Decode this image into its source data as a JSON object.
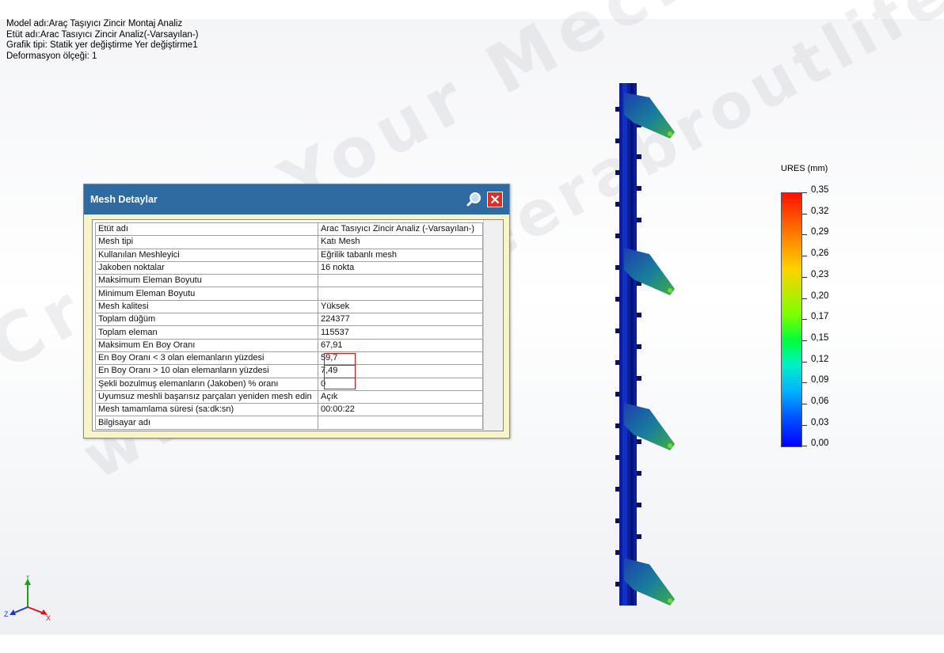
{
  "header": {
    "model_name": "Model adı:Araç Taşıyıcı Zincir Montaj Analiz",
    "study_name": "Etüt adı:Arac Tasıyıcı Zincir Analiz(-Varsayılan-)",
    "plot_type": "Grafik tipi: Statik yer değiştirme Yer değiştirme1",
    "deformation_scale": "Deformasyon ölçeği: 1"
  },
  "watermark": {
    "line1": "Create Your Mech Engg Caglar",
    "line2": "www.engineerabroutlife.com"
  },
  "dialog": {
    "title": "Mesh Detaylar",
    "zoom_icon": "magnifier-icon",
    "close_icon": "close-icon",
    "rows": [
      {
        "label": "Etüt adı",
        "value": "Arac Tasıyıcı Zincir Analiz (-Varsayılan-)"
      },
      {
        "label": "Mesh tipi",
        "value": "Katı Mesh"
      },
      {
        "label": "Kullanılan Meshleyici",
        "value": "Eğrilik tabanlı mesh"
      },
      {
        "label": "Jakoben noktalar",
        "value": "16 nokta"
      },
      {
        "label": "Maksimum Eleman Boyutu",
        "value": ""
      },
      {
        "label": "Minimum Eleman Boyutu",
        "value": ""
      },
      {
        "label": "Mesh kalitesi",
        "value": "Yüksek"
      },
      {
        "label": "Toplam düğüm",
        "value": "224377"
      },
      {
        "label": "Toplam eleman",
        "value": "115537"
      },
      {
        "label": "Maksimum En Boy Oranı",
        "value": "67,91"
      },
      {
        "label": "En Boy Oranı < 3 olan elemanların yüzdesi",
        "value": "59,7"
      },
      {
        "label": "En Boy Oranı > 10 olan elemanların yüzdesi",
        "value": "7,49"
      },
      {
        "label": "Şekli bozulmuş elemanların (Jakoben) % oranı",
        "value": "0"
      },
      {
        "label": "Uyumsuz meshli başarısız parçaları yeniden mesh edin",
        "value": "Açık"
      },
      {
        "label": "Mesh tamamlama süresi (sa:dk:sn)",
        "value": "00:00:22"
      },
      {
        "label": "Bilgisayar adı",
        "value": ""
      }
    ]
  },
  "legend": {
    "title": "URES (mm)",
    "labels": [
      "0,35",
      "0,32",
      "0,29",
      "0,26",
      "0,23",
      "0,20",
      "0,17",
      "0,15",
      "0,12",
      "0,09",
      "0,06",
      "0,03",
      "0,00"
    ],
    "colors": {
      "max": "#ff1100",
      "mid": "#00ff3a",
      "min": "#0000ff"
    }
  },
  "triad": {
    "x": "X",
    "y": "Y",
    "z": "Z",
    "colors": {
      "x": "#d6141a",
      "y": "#1aa01a",
      "z": "#1a3ad6"
    }
  }
}
